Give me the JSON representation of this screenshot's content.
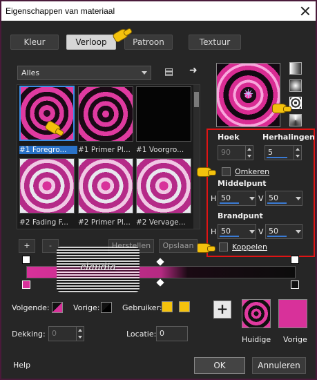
{
  "window": {
    "title": "Eigenschappen van materiaal"
  },
  "tabs": [
    {
      "label": "Kleur"
    },
    {
      "label": "Verloop",
      "active": true
    },
    {
      "label": "Patroon"
    },
    {
      "label": "Textuur"
    }
  ],
  "category": {
    "selected": "Alles"
  },
  "gradients": [
    {
      "label": "#1 Foregro...",
      "selected": true
    },
    {
      "label": "#1 Primer Pl..."
    },
    {
      "label": "#1 Voorgro..."
    },
    {
      "label": "#2 Fading F..."
    },
    {
      "label": "#2 Primer Pl..."
    },
    {
      "label": "#2 Vervage..."
    }
  ],
  "settings": {
    "angle_label": "Hoek",
    "angle_value": "90",
    "repeats_label": "Herhalingen",
    "repeats_value": "5",
    "invert_label": "Omkeren",
    "center_label": "Middelpunt",
    "center_h_label": "H",
    "center_h": "50",
    "center_v_label": "V",
    "center_v": "50",
    "focal_label": "Brandpunt",
    "focal_h_label": "H",
    "focal_h": "50",
    "focal_v_label": "V",
    "focal_v": "50",
    "link_label": "Koppelen"
  },
  "editor": {
    "add_label": "+",
    "remove_label": "-",
    "reset_label": "Herstellen",
    "save_label": "Opslaan",
    "watermark_text": "claudia"
  },
  "stops": {
    "follow_label": "Volgende:",
    "previous_label": "Vorige:",
    "user_label": "Gebruiker:",
    "opacity_label": "Dekking:",
    "opacity_value": "0",
    "location_label": "Locatie:",
    "location_value": "0"
  },
  "current": {
    "current_label": "Huidige",
    "previous_label": "Vorige"
  },
  "footer": {
    "help_label": "Help",
    "ok_label": "OK",
    "cancel_label": "Annuleren"
  },
  "colors": {
    "accent": "#d8319a",
    "highlight_box": "#e01414",
    "selection": "#2a72c8",
    "user_color": "#f4c20d"
  },
  "icons": [
    "close-icon",
    "library-icon",
    "arrow-right-icon",
    "pointer-hand-icon",
    "plus-icon"
  ]
}
